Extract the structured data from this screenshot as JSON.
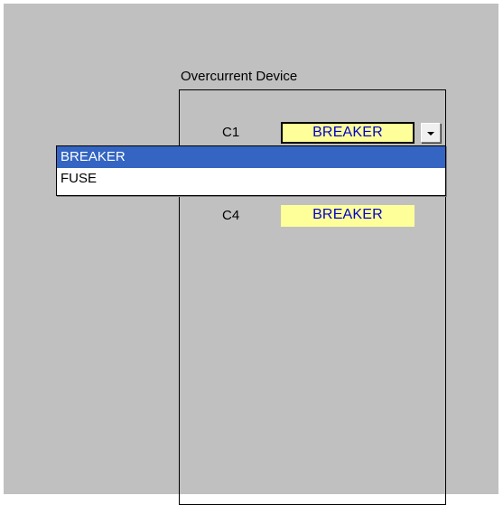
{
  "group": {
    "title": "Overcurrent Device"
  },
  "rows": [
    {
      "label": "C1",
      "value": "BREAKER"
    },
    {
      "label": "C4",
      "value": "BREAKER"
    }
  ],
  "dropdown": {
    "options": [
      "BREAKER",
      "FUSE"
    ],
    "highlighted": "BREAKER"
  },
  "colors": {
    "sheet_background": "#c0c0c0",
    "cell_fill": "#ffff99",
    "cell_text": "#0000cc",
    "selection_highlight": "#3465c2"
  },
  "icons": {
    "dropdown": "chevron-down-icon"
  }
}
